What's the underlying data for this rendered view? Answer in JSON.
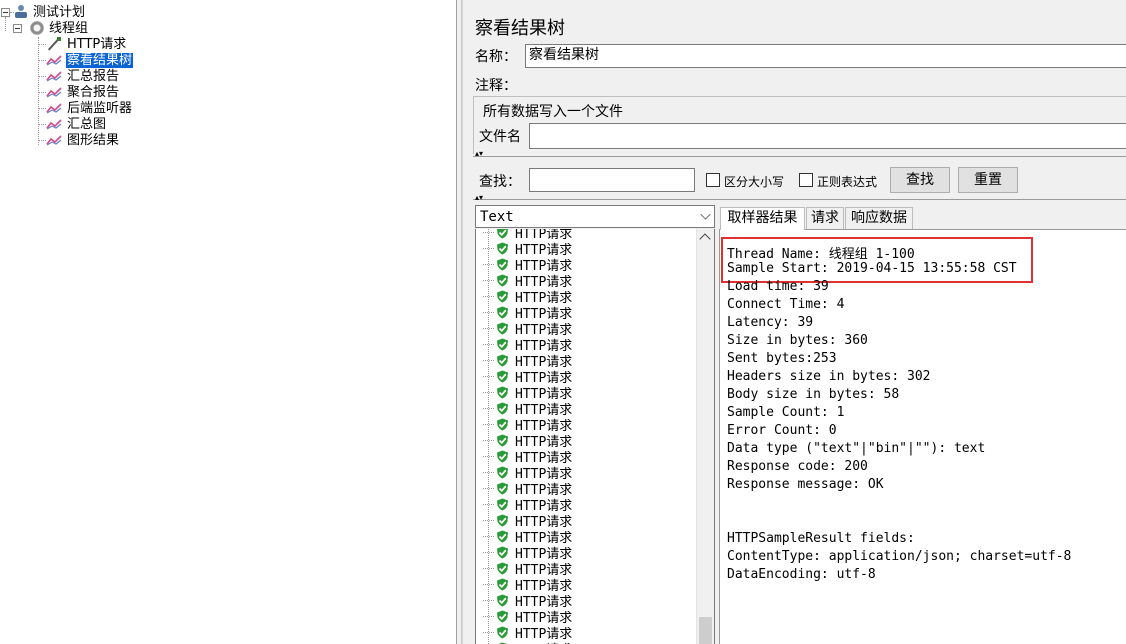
{
  "tree": {
    "test_plan": "测试计划",
    "thread_group": "线程组",
    "children": [
      {
        "label": "HTTP请求",
        "icon": "http-sampler-icon"
      },
      {
        "label": "察看结果树",
        "icon": "listener-graph-icon",
        "selected": true
      },
      {
        "label": "汇总报告",
        "icon": "listener-graph-icon"
      },
      {
        "label": "聚合报告",
        "icon": "listener-graph-icon"
      },
      {
        "label": "后端监听器",
        "icon": "listener-graph-icon"
      },
      {
        "label": "汇总图",
        "icon": "listener-graph-icon"
      },
      {
        "label": "图形结果",
        "icon": "listener-graph-icon"
      }
    ]
  },
  "panel": {
    "title": "察看结果树",
    "name_label": "名称：",
    "name_value": "察看结果树",
    "comment_label": "注释：",
    "comment_value": "",
    "file_group_title": "所有数据写入一个文件",
    "filename_label": "文件名",
    "filename_value": ""
  },
  "search": {
    "label": "查找：",
    "value": "",
    "case_sensitive_label": "区分大小写",
    "regex_label": "正则表达式",
    "find_button": "查找",
    "reset_button": "重置"
  },
  "renderer": {
    "selected": "Text"
  },
  "results": {
    "item_label": "HTTP请求",
    "status_icon": "success-shield-icon",
    "items": [
      "HTTP请求",
      "HTTP请求",
      "HTTP请求",
      "HTTP请求",
      "HTTP请求",
      "HTTP请求",
      "HTTP请求",
      "HTTP请求",
      "HTTP请求",
      "HTTP请求",
      "HTTP请求",
      "HTTP请求",
      "HTTP请求",
      "HTTP请求",
      "HTTP请求",
      "HTTP请求",
      "HTTP请求",
      "HTTP请求",
      "HTTP请求",
      "HTTP请求",
      "HTTP请求",
      "HTTP请求",
      "HTTP请求",
      "HTTP请求",
      "HTTP请求",
      "HTTP请求",
      "HTTP请求"
    ]
  },
  "tabs": [
    {
      "label": "取样器结果",
      "active": true
    },
    {
      "label": "请求",
      "active": false
    },
    {
      "label": "响应数据",
      "active": false
    }
  ],
  "sampler_result": [
    "Thread Name: 线程组 1-100",
    "Sample Start: 2019-04-15 13:55:58 CST",
    "Load time: 39",
    "Connect Time: 4",
    "Latency: 39",
    "Size in bytes: 360",
    "Sent bytes:253",
    "Headers size in bytes: 302",
    "Body size in bytes: 58",
    "Sample Count: 1",
    "Error Count: 0",
    "Data type (\"text\"|\"bin\"|\"\"): text",
    "Response code: 200",
    "Response message: OK",
    "",
    "",
    "HTTPSampleResult fields:",
    "ContentType: application/json; charset=utf-8",
    "DataEncoding: utf-8"
  ],
  "colors": {
    "selection": "#0a64d6",
    "highlight_box": "#e03030",
    "success_green": "#2e9b3a"
  }
}
